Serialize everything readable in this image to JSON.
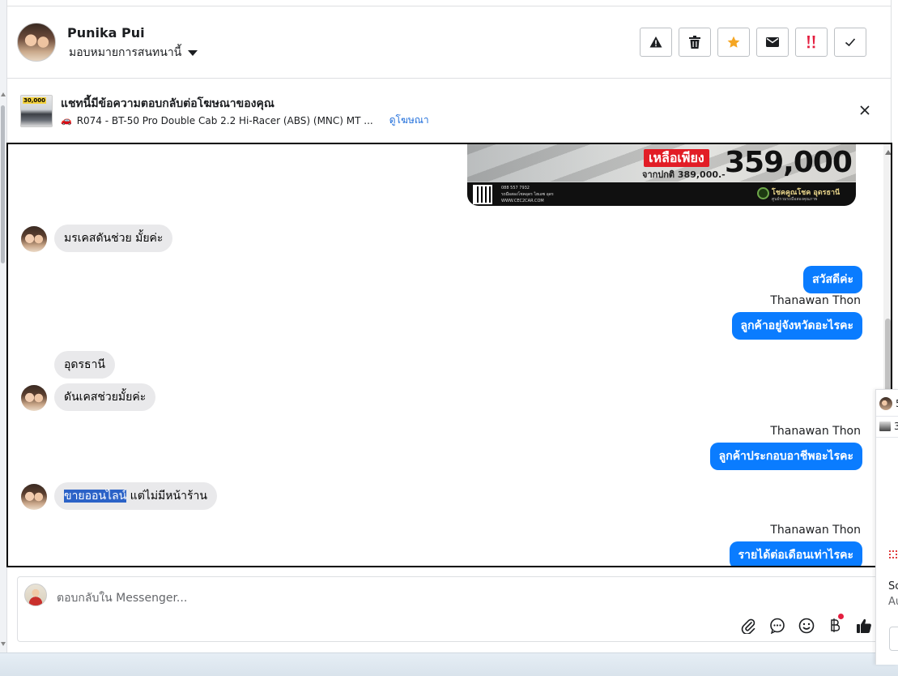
{
  "header": {
    "user_name": "Punika Pui",
    "assign_label": "มอบหมายการสนทนานี้",
    "toolbar": [
      {
        "name": "spam-warning-button",
        "icon": "warning-triangle-icon"
      },
      {
        "name": "delete-button",
        "icon": "trash-icon"
      },
      {
        "name": "star-button",
        "icon": "star-icon",
        "color": "#f5a623"
      },
      {
        "name": "mark-unread-button",
        "icon": "envelope-icon"
      },
      {
        "name": "follow-up-button",
        "icon": "double-exclamation-icon",
        "color": "#e41e3f"
      },
      {
        "name": "mark-done-button",
        "icon": "checkmark-icon"
      }
    ]
  },
  "ad_bar": {
    "title": "แชทนี้มีข้อความตอบกลับต่อโฆษณาของคุณ",
    "thumb_tag": "30,000",
    "ad_text": "R074 - BT-50 Pro Double Cab 2.2 Hi-Racer (ABS) (MNC) MT ...",
    "view_ad_link": "ดูโฆษณา"
  },
  "promo_image": {
    "badge": "เหลือเพียง",
    "original_label": "จากปกติ 389,000.-",
    "price": "359,000",
    "phone": "088 557 7932",
    "facebook": "รถมือสองโชคอุดร ไฮเอซ อุดร",
    "website": "WWW.CEC2CAR.COM",
    "brand": "โชคคูณโชค อุดรธานี",
    "brand_sub": "ศูนย์รวมรถมือสองคุณภาพ"
  },
  "messages": [
    {
      "id": "m1",
      "direction": "in",
      "text": "มรเคสดันช่วย มั้ยค่ะ"
    },
    {
      "id": "m2",
      "direction": "out",
      "text": "สวัสดีค่ะ"
    },
    {
      "id": "m3",
      "direction": "out",
      "sender": "Thanawan Thon",
      "text": "ลูกค้าอยู่จังหวัดอะไรคะ"
    },
    {
      "id": "m4",
      "direction": "in",
      "text": "อุดรธานี"
    },
    {
      "id": "m5",
      "direction": "in",
      "text": "ดันเคสช่วยมั้ยค่ะ"
    },
    {
      "id": "m6",
      "direction": "out",
      "sender": "Thanawan Thon",
      "text": "ลูกค้าประกอบอาชีพอะไรคะ"
    },
    {
      "id": "m7",
      "direction": "in",
      "text_highlight": "ขายออนไลน์",
      "text_rest": " แต่ไม่มีหน้าร้าน"
    },
    {
      "id": "m8",
      "direction": "out",
      "sender": "Thanawan Thon",
      "text": "รายได้ต่อเดือนเท่าไรคะ"
    }
  ],
  "composer": {
    "placeholder": "ตอบกลับใน Messenger...",
    "icons": [
      "paperclip-icon",
      "saved-replies-icon",
      "emoji-icon",
      "baht-payment-icon",
      "thumbs-up-icon"
    ]
  },
  "side_panel": {
    "row1_text": "5",
    "row2_text": "3",
    "text1": "Sc",
    "text2": "Au"
  }
}
